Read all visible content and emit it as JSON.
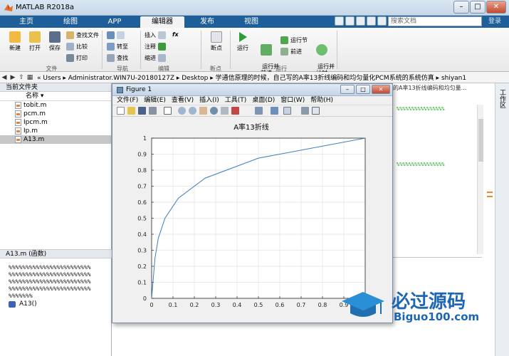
{
  "app": {
    "title": "MATLAB R2018a",
    "window_buttons": [
      "–",
      "□",
      "✕"
    ]
  },
  "tabs": [
    "主页",
    "绘图",
    "APP",
    "编辑器",
    "发布",
    "视图"
  ],
  "active_tab": "编辑器",
  "search_placeholder": "搜索文档",
  "login_label": "登录",
  "ribbon": {
    "file_group": {
      "new": "新建",
      "open": "打开",
      "save": "保存",
      "find_files": "查找文件",
      "compare": "比较",
      "print": "打印",
      "label": "文件"
    },
    "nav_group": {
      "goto": "转至",
      "find": "查找",
      "label": "导航"
    },
    "edit_group": {
      "insert": "插入",
      "comment": "注释",
      "indent": "缩进",
      "fx": "fx",
      "label": "编辑"
    },
    "breakpoint_group": {
      "breakpoints": "断点",
      "label": "断点"
    },
    "run_group": {
      "run": "运行",
      "run_advance": "运行并\n前进",
      "run_section": "运行节",
      "advance": "前进",
      "run_time": "运行并\n计时",
      "label": "运行"
    }
  },
  "address": {
    "path": "« Users ▸ Administrator.WIN7U-20180127Z ▸ Desktop ▸ 学通信原理的时候，自己写的A率13折线编码和均匀量化PCM系统的系统仿真 ▸ shiyan1"
  },
  "left_panel": {
    "header": "当前文件夹",
    "column": "名称 ▾",
    "files": [
      "tobit.m",
      "pcm.m",
      "Ipcm.m",
      "Ip.m",
      "A13.m"
    ],
    "selected": "A13.m",
    "details_header": "A13.m   (函数)",
    "details_lines": "%%%%%%%%%%%%%%%%%%%%%%%%\n%%%%%%%%%%%%%%%%%%%%%%%%\n%%%%%%%%%%%%%%%%%%%%%%%%\n%%%%%%%%%%%%%%%%%%%%%%%%\n%%%%%%%",
    "details_func": "A13()"
  },
  "editor": {
    "tab_title": "的A率13折线编码和均匀量...",
    "side_label": "工作区"
  },
  "figure": {
    "title": "Figure 1",
    "menu": [
      "文件(F)",
      "编辑(E)",
      "查看(V)",
      "插入(I)",
      "工具(T)",
      "桌面(D)",
      "窗口(W)",
      "帮助(H)"
    ]
  },
  "chart_data": {
    "type": "line",
    "title": "A率13折线",
    "xlabel": "",
    "ylabel": "",
    "xlim": [
      0,
      1
    ],
    "ylim": [
      0,
      1
    ],
    "xticks": [
      0,
      0.1,
      0.2,
      0.3,
      0.4,
      0.5,
      0.6,
      0.7,
      0.8,
      0.9
    ],
    "yticks": [
      0,
      0.1,
      0.2,
      0.3,
      0.4,
      0.5,
      0.6,
      0.7,
      0.8,
      0.9,
      1
    ],
    "grid": true,
    "color": "#3b7bbf",
    "x": [
      0,
      0.0078,
      0.0156,
      0.03125,
      0.0625,
      0.125,
      0.25,
      0.5,
      1
    ],
    "y": [
      0,
      0.125,
      0.25,
      0.375,
      0.5,
      0.625,
      0.75,
      0.875,
      1
    ]
  },
  "watermark": {
    "brand": "必过源码",
    "url": "Biguo100.com"
  }
}
